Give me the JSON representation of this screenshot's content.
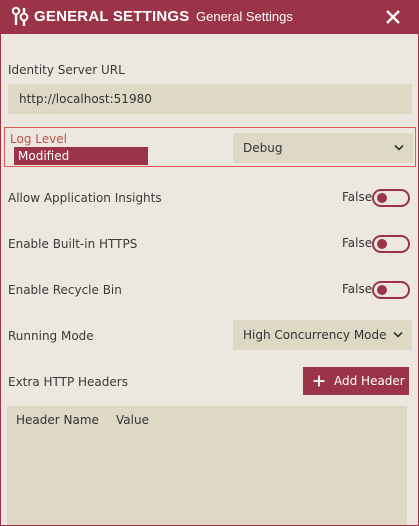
{
  "header": {
    "title": "GENERAL SETTINGS",
    "subtitle": "General Settings",
    "title_icon": "wrench-settings-icon",
    "close_icon": "close-icon"
  },
  "identity_server": {
    "label": "Identity Server URL",
    "value": "http://localhost:51980"
  },
  "log_level": {
    "label": "Log Level",
    "modified_badge": "Modified",
    "selected": "Debug"
  },
  "toggles": [
    {
      "label": "Allow Application Insights",
      "state": "False"
    },
    {
      "label": "Enable Built-in HTTPS",
      "state": "False"
    },
    {
      "label": "Enable Recycle Bin",
      "state": "False"
    }
  ],
  "running_mode": {
    "label": "Running Mode",
    "selected": "High Concurrency Mode"
  },
  "extra_headers": {
    "label": "Extra HTTP Headers",
    "add_button": "Add Header",
    "columns": [
      "Header Name",
      "Value"
    ]
  },
  "colors": {
    "accent": "#9b3446",
    "background": "#ece8df",
    "field": "#ddd9c4",
    "modified_border": "#e05a5a"
  }
}
